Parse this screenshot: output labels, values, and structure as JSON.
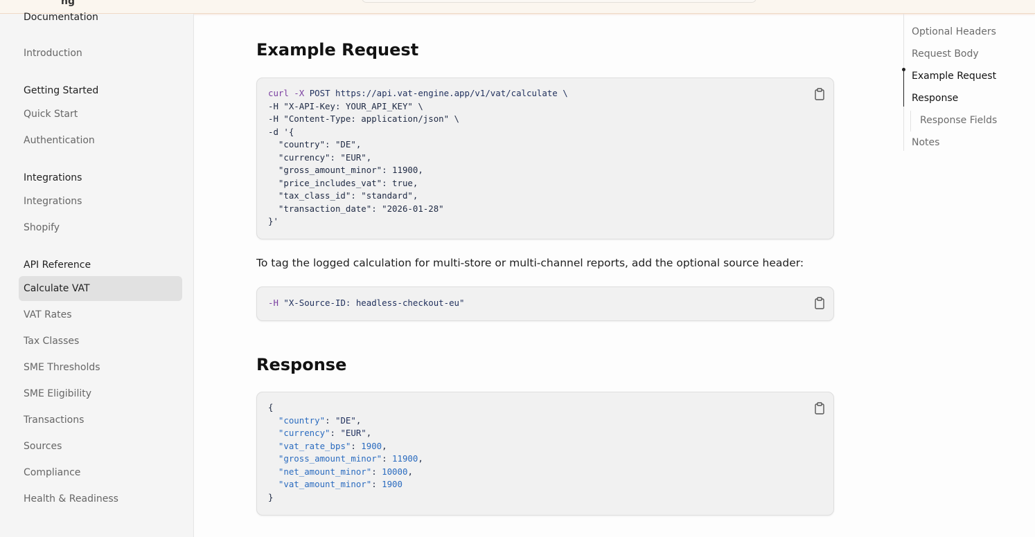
{
  "topbar": {
    "brand": "ng"
  },
  "sidebar": {
    "groups": [
      {
        "title": "Documentation",
        "items": [
          "Introduction"
        ]
      },
      {
        "title": "Getting Started",
        "items": [
          "Quick Start",
          "Authentication"
        ]
      },
      {
        "title": "Integrations",
        "items": [
          "Integrations",
          "Shopify"
        ]
      },
      {
        "title": "API Reference",
        "items": [
          "Calculate VAT",
          "VAT Rates",
          "Tax Classes",
          "SME Thresholds",
          "SME Eligibility",
          "Transactions",
          "Sources",
          "Compliance",
          "Health & Readiness"
        ]
      }
    ],
    "active_item": "Calculate VAT"
  },
  "main": {
    "example_request": {
      "title": "Example Request",
      "lines": [
        [
          "curl",
          " -X",
          " POST https://api.vat-engine.app/v1/vat/calculate \\"
        ],
        "-H \"X-API-Key: YOUR_API_KEY\" \\",
        "-H \"Content-Type: application/json\" \\",
        "-d '{",
        "  \"country\": \"DE\",",
        "  \"currency\": \"EUR\",",
        "  \"gross_amount_minor\": 11900,",
        "  \"price_includes_vat\": true,",
        "  \"tax_class_id\": \"standard\",",
        "  \"transaction_date\": \"2026-01-28\"",
        "}'"
      ]
    },
    "source_note": "To tag the logged calculation for multi-store or multi-channel reports, add the optional source header:",
    "source_header": {
      "flag": "-H",
      "value": " \"X-Source-ID: headless-checkout-eu\""
    },
    "response": {
      "title": "Response",
      "open": "{",
      "fields": [
        {
          "key": "\"country\"",
          "value": "\"DE\"",
          "kind": "str"
        },
        {
          "key": "\"currency\"",
          "value": "\"EUR\"",
          "kind": "str"
        },
        {
          "key": "\"vat_rate_bps\"",
          "value": "1900",
          "kind": "num"
        },
        {
          "key": "\"gross_amount_minor\"",
          "value": "11900",
          "kind": "num"
        },
        {
          "key": "\"net_amount_minor\"",
          "value": "10000",
          "kind": "num"
        },
        {
          "key": "\"vat_amount_minor\"",
          "value": "1900",
          "kind": "num"
        }
      ],
      "close": "}"
    }
  },
  "toc": {
    "items": [
      {
        "label": "Optional Headers",
        "level": 1
      },
      {
        "label": "Request Body",
        "level": 1
      },
      {
        "label": "Example Request",
        "level": 1,
        "active": true
      },
      {
        "label": "Response",
        "level": 1,
        "active": true
      },
      {
        "label": "Response Fields",
        "level": 2
      },
      {
        "label": "Notes",
        "level": 1
      }
    ]
  },
  "icons": {
    "copy": "clipboard-icon"
  }
}
